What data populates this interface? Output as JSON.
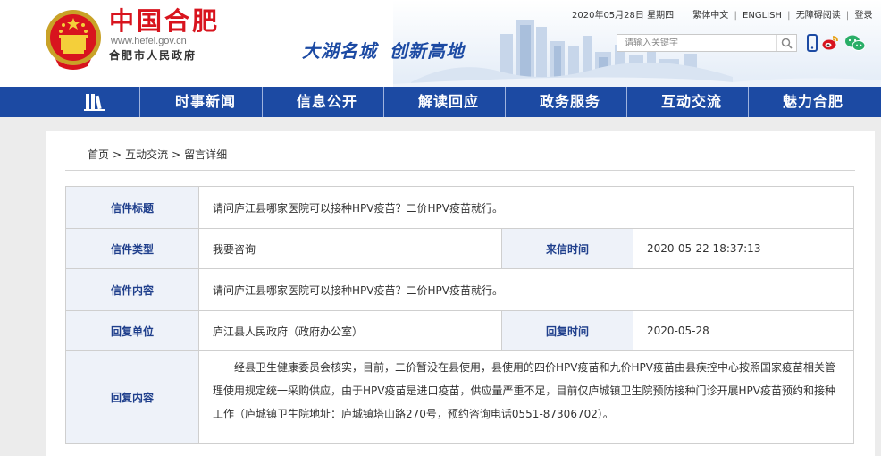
{
  "header": {
    "site_name": "中国合肥",
    "site_url": "www.hefei.gov.cn",
    "site_org": "合肥市人民政府",
    "slogan_part1": "大湖名城",
    "slogan_part2": "创新高地",
    "date": "2020年05月28日 星期四",
    "links": {
      "traditional": "繁体中文",
      "english": "ENGLISH",
      "accessible": "无障碍阅读",
      "login": "登录"
    },
    "search": {
      "placeholder": "请输入关键字"
    },
    "icons": [
      "mobile-icon",
      "weibo-icon",
      "wechat-icon",
      "search-icon"
    ],
    "brand_red": "#d8141e"
  },
  "nav": {
    "home_icon": "book-icon",
    "items": [
      {
        "label": "时事新闻"
      },
      {
        "label": "信息公开"
      },
      {
        "label": "解读回应"
      },
      {
        "label": "政务服务"
      },
      {
        "label": "互动交流"
      },
      {
        "label": "魅力合肥"
      }
    ],
    "color": "#1c4aa3"
  },
  "breadcrumb": [
    "首页",
    "互动交流",
    "留言详细"
  ],
  "breadcrumb_separator": ">",
  "letter": {
    "title_label": "信件标题",
    "title": "请问庐江县哪家医院可以接种HPV疫苗？二价HPV疫苗就行。",
    "type_label": "信件类型",
    "type": "我要咨询",
    "time_label": "来信时间",
    "time": "2020-05-22 18:37:13",
    "content_label": "信件内容",
    "content": "请问庐江县哪家医院可以接种HPV疫苗？二价HPV疫苗就行。",
    "reply_unit_label": "回复单位",
    "reply_unit": "庐江县人民政府（政府办公室）",
    "reply_time_label": "回复时间",
    "reply_time": "2020-05-28",
    "reply_content_label": "回复内容",
    "reply_content": "经县卫生健康委员会核实，目前，二价暂没在县使用，县使用的四价HPV疫苗和九价HPV疫苗由县疾控中心按照国家疫苗相关管理使用规定统一采购供应，由于HPV疫苗是进口疫苗，供应量严重不足，目前仅庐城镇卫生院预防接种门诊开展HPV疫苗预约和接种工作（庐城镇卫生院地址：庐城镇塔山路270号，预约咨询电话0551-87306702）。"
  }
}
